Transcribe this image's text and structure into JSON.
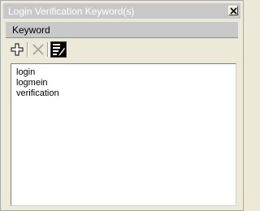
{
  "window": {
    "title": "Login Verification Keyword(s)"
  },
  "header": {
    "label": "Keyword"
  },
  "toolbar": {
    "buttons": [
      {
        "icon": "plus-icon",
        "enabled": true
      },
      {
        "icon": "x-icon",
        "enabled": false
      },
      {
        "icon": "edit-icon",
        "enabled": true
      }
    ]
  },
  "list": {
    "items": [
      "login",
      "logmein",
      "verification"
    ]
  },
  "colors": {
    "titlebar": "#c8c8c8",
    "header": "#c9c9c9",
    "window_bg": "#ece9d8"
  }
}
